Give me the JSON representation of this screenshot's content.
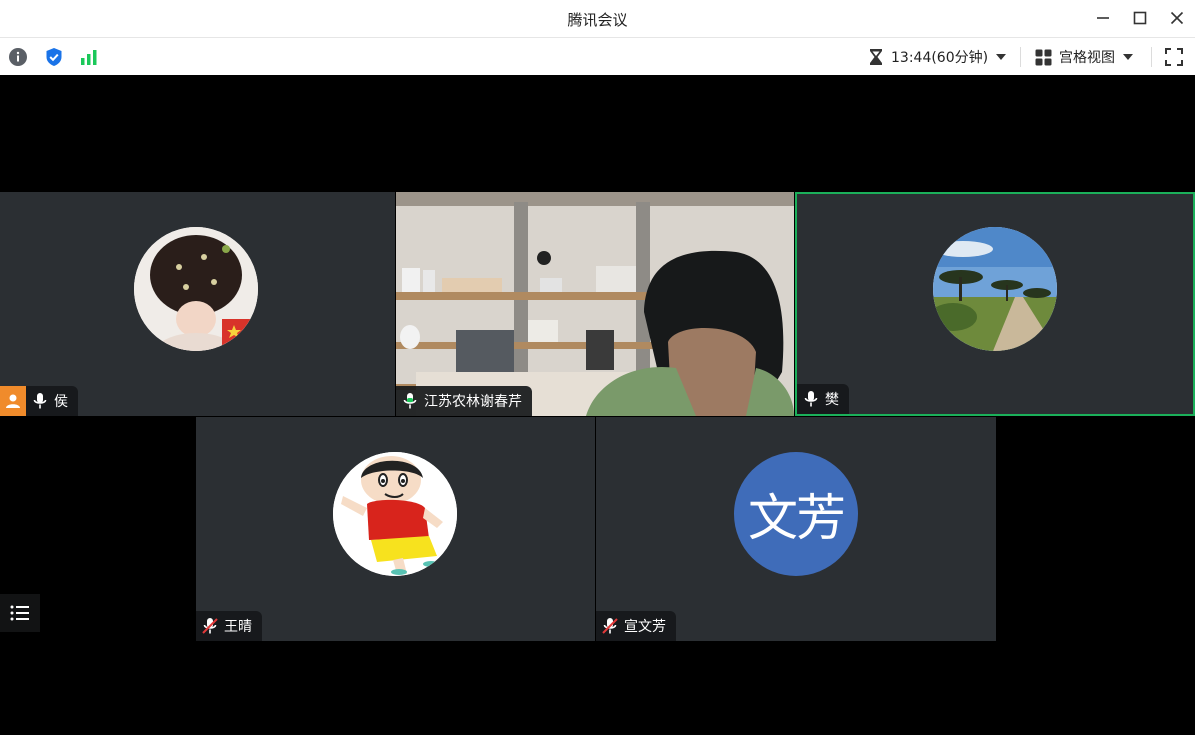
{
  "window": {
    "title": "腾讯会议"
  },
  "toolbar": {
    "timer_text": "13:44(60分钟)",
    "view_label": "宫格视图",
    "icons": [
      "info-icon",
      "shield-check-icon",
      "signal-bars-icon",
      "hourglass-icon",
      "grid-view-icon",
      "fullscreen-icon"
    ]
  },
  "colors": {
    "tile_bg": "#2b2f33",
    "active_border": "#1bb05a",
    "host_badge": "#f08b2b",
    "mic_active": "#1bc85a",
    "text_avatar_bg": "#3f6cb9",
    "shield": "#1a73e8",
    "signal": "#1bc85a"
  },
  "participants": [
    {
      "name": "侯",
      "mic": "on",
      "host": true,
      "avatar": "photo-hair"
    },
    {
      "name": "江苏农林谢春芹",
      "mic": "speaking",
      "video": true
    },
    {
      "name": "樊",
      "mic": "on",
      "active": true,
      "avatar": "photo-landscape"
    },
    {
      "name": "王晴",
      "mic": "muted",
      "avatar": "cartoon"
    },
    {
      "name": "宣文芳",
      "mic": "muted",
      "avatar_text": "文芳"
    }
  ]
}
